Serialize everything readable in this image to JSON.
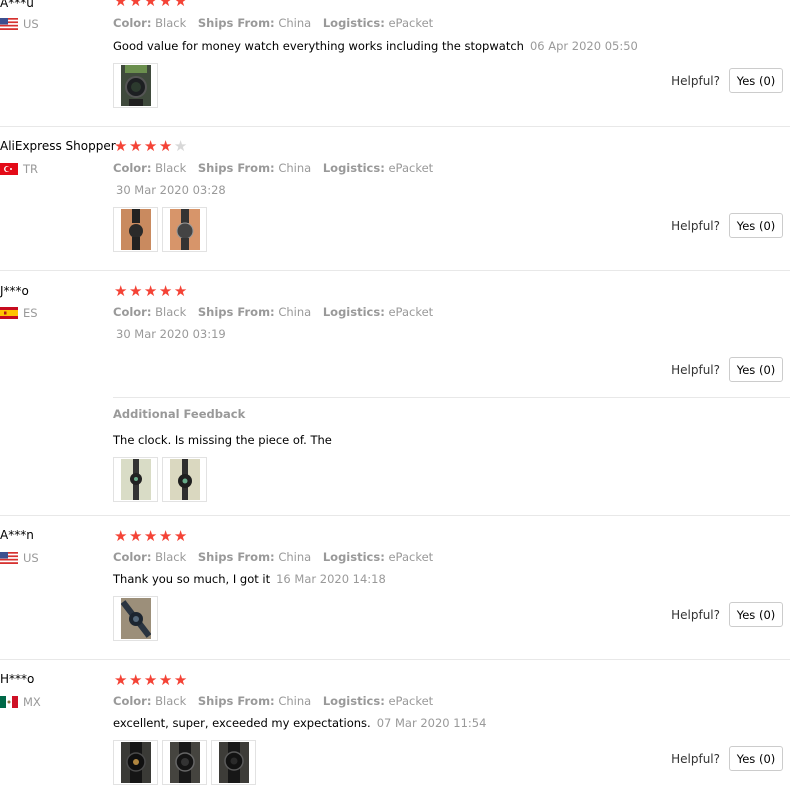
{
  "reviews": [
    {
      "user": "A***u",
      "country": "US",
      "rating": 5,
      "color_label": "Color:",
      "color_value": "Black",
      "ships_label": "Ships From:",
      "ships_value": "China",
      "logistics_label": "Logistics:",
      "logistics_value": "ePacket",
      "text": "Good value for money watch everything works including the stopwatch",
      "date": "06 Apr 2020 05:50",
      "helpful_label": "Helpful?",
      "yes_label": "Yes (0)"
    },
    {
      "user": "AliExpress Shopper",
      "country": "TR",
      "rating": 4,
      "color_label": "Color:",
      "color_value": "Black",
      "ships_label": "Ships From:",
      "ships_value": "China",
      "logistics_label": "Logistics:",
      "logistics_value": "ePacket",
      "text": "",
      "date": "30 Mar 2020 03:28",
      "helpful_label": "Helpful?",
      "yes_label": "Yes (0)"
    },
    {
      "user": "J***o",
      "country": "ES",
      "rating": 5,
      "color_label": "Color:",
      "color_value": "Black",
      "ships_label": "Ships From:",
      "ships_value": "China",
      "logistics_label": "Logistics:",
      "logistics_value": "ePacket",
      "text": "",
      "date": "30 Mar 2020 03:19",
      "helpful_label": "Helpful?",
      "yes_label": "Yes (0)",
      "additional_title": "Additional Feedback",
      "additional_text": "The clock. Is missing the piece of. The"
    },
    {
      "user": "A***n",
      "country": "US",
      "rating": 5,
      "color_label": "Color:",
      "color_value": "Black",
      "ships_label": "Ships From:",
      "ships_value": "China",
      "logistics_label": "Logistics:",
      "logistics_value": "ePacket",
      "text": "Thank you so much, I got it",
      "date": "16 Mar 2020 14:18",
      "helpful_label": "Helpful?",
      "yes_label": "Yes (0)"
    },
    {
      "user": "H***o",
      "country": "MX",
      "rating": 5,
      "color_label": "Color:",
      "color_value": "Black",
      "ships_label": "Ships From:",
      "ships_value": "China",
      "logistics_label": "Logistics:",
      "logistics_value": "ePacket",
      "text": "excellent, super, exceeded my expectations.",
      "date": "07 Mar 2020 11:54",
      "helpful_label": "Helpful?",
      "yes_label": "Yes (0)"
    }
  ],
  "colors": {
    "star_on": "#f44336",
    "star_off": "#d8d8d8",
    "muted_text": "#999999"
  }
}
